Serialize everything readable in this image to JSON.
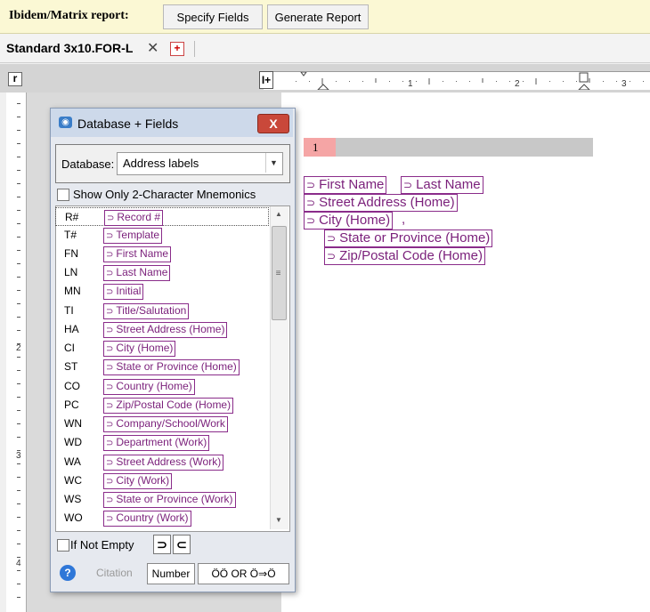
{
  "report_bar": {
    "title": "Ibidem/Matrix report:",
    "specify_fields": "Specify Fields",
    "generate_report": "Generate Report"
  },
  "document_tab": {
    "name": "Standard 3x10.FOR-L",
    "close_glyph": "✕",
    "add_glyph": "+"
  },
  "ruler": {
    "corner_glyph": "r",
    "indent_glyph": "I+",
    "numbers": [
      "1",
      "2",
      "3"
    ],
    "vertical_numbers": [
      "2",
      "3",
      "4"
    ]
  },
  "page": {
    "record_number": "1",
    "fields": {
      "first_name": "First Name",
      "last_name": "Last Name",
      "street_address": "Street Address (Home)",
      "city": "City (Home)",
      "state": "State or Province (Home)",
      "zip": "Zip/Postal Code (Home)"
    },
    "city_trailing": ","
  },
  "dialog": {
    "title": "Database + Fields",
    "close_glyph": "X",
    "database_label": "Database:",
    "database_value": "Address labels",
    "dropdown_glyph": "▼",
    "mnemonics_label": "Show Only 2-Character Mnemonics",
    "fields": [
      {
        "code": "R#",
        "name": "Record #"
      },
      {
        "code": "T#",
        "name": "Template"
      },
      {
        "code": "FN",
        "name": "First Name"
      },
      {
        "code": "LN",
        "name": "Last Name"
      },
      {
        "code": "MN",
        "name": "Initial"
      },
      {
        "code": "TI",
        "name": "Title/Salutation"
      },
      {
        "code": "HA",
        "name": "Street Address (Home)"
      },
      {
        "code": "CI",
        "name": "City (Home)"
      },
      {
        "code": "ST",
        "name": "State or Province (Home)"
      },
      {
        "code": "CO",
        "name": "Country (Home)"
      },
      {
        "code": "PC",
        "name": "Zip/Postal Code (Home)"
      },
      {
        "code": "WN",
        "name": "Company/School/Work"
      },
      {
        "code": "WD",
        "name": "Department (Work)"
      },
      {
        "code": "WA",
        "name": "Street Address (Work)"
      },
      {
        "code": "WC",
        "name": "City (Work)"
      },
      {
        "code": "WS",
        "name": "State or Province (Work)"
      },
      {
        "code": "WO",
        "name": "Country (Work)"
      }
    ],
    "if_not_empty_label": "If Not Empty",
    "open_arrow": "⊃",
    "close_arrow": "⊂",
    "help_glyph": "?",
    "citation_label": "Citation",
    "number_label": "Number",
    "quote_style": "ÖÖ OR Ö⇒Ö"
  },
  "colors": {
    "field_border": "#8a2c8a",
    "field_text": "#7a1f7a",
    "record_highlight": "#f5a5a5",
    "report_bar": "#fbf8d4"
  }
}
